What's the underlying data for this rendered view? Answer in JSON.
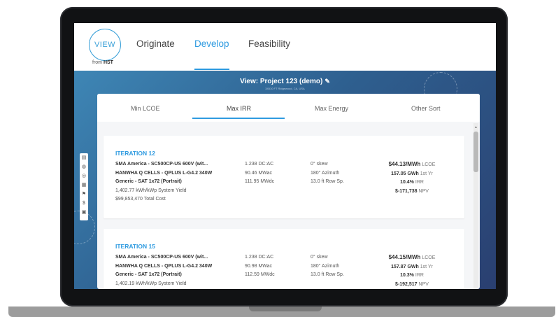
{
  "app": {
    "logo": {
      "main": "VIEW",
      "sub_prefix": "from",
      "sub_brand": "HST"
    },
    "nav": [
      {
        "label": "Originate",
        "active": false
      },
      {
        "label": "Develop",
        "active": true
      },
      {
        "label": "Feasibility",
        "active": false
      }
    ]
  },
  "hero": {
    "title": "View: Project 123 (demo)",
    "subtitle": "34510 FT Ridgewood, CA, USA",
    "edit_icon": "pencil-icon"
  },
  "toolbar_icons": [
    "document-icon",
    "globe-icon",
    "target-icon",
    "grid-icon",
    "flag-icon",
    "dollar-icon",
    "table-icon"
  ],
  "sort_tabs": [
    {
      "label": "Min LCOE",
      "active": false
    },
    {
      "label": "Max IRR",
      "active": true
    },
    {
      "label": "Max Energy",
      "active": false
    },
    {
      "label": "Other Sort",
      "active": false
    }
  ],
  "iterations": [
    {
      "title": "ITERATION 12",
      "equipment": [
        "SMA America - SC500CP-US 600V (wit...",
        "HANWHA Q CELLS - QPLUS L-G4.2 340W",
        "Generic - SAT 1x72 (Portrait)"
      ],
      "yield": "1,402.77 kWh/kWp System Yield",
      "total_cost": "$99,853,470 Total Cost",
      "specs": [
        "1.238 DC:AC",
        "90.46 MWac",
        "111.95 MWdc"
      ],
      "layout": [
        "0° skew",
        "180° Azimuth",
        "13.0 ft Row Sp."
      ],
      "lcoe_value": "$44.13/MWh",
      "lcoe_label": "LCOE",
      "energy_value": "157.05 GWh",
      "energy_label": "1st Yr",
      "irr_value": "10.4%",
      "irr_label": "IRR",
      "npv_value": "$-171,738",
      "npv_label": "NPV"
    },
    {
      "title": "ITERATION 15",
      "equipment": [
        "SMA America - SC500CP-US 600V (wit...",
        "HANWHA Q CELLS - QPLUS L-G4.2 340W",
        "Generic - SAT 1x72 (Portrait)"
      ],
      "yield": "1,402.19 kWh/kWp System Yield",
      "specs": [
        "1.238 DC:AC",
        "90.98 MWac",
        "112.59 MWdc"
      ],
      "layout": [
        "0° skew",
        "180° Azimuth",
        "13.0 ft Row Sp."
      ],
      "lcoe_value": "$44.15/MWh",
      "lcoe_label": "LCOE",
      "energy_value": "157.87 GWh",
      "energy_label": "1st Yr",
      "irr_value": "10.3%",
      "irr_label": "IRR",
      "npv_value": "$-192,517",
      "npv_label": "NPV"
    }
  ],
  "colors": {
    "accent": "#2f9be0",
    "hero_start": "#3e86b5",
    "hero_end": "#2a3f70"
  }
}
